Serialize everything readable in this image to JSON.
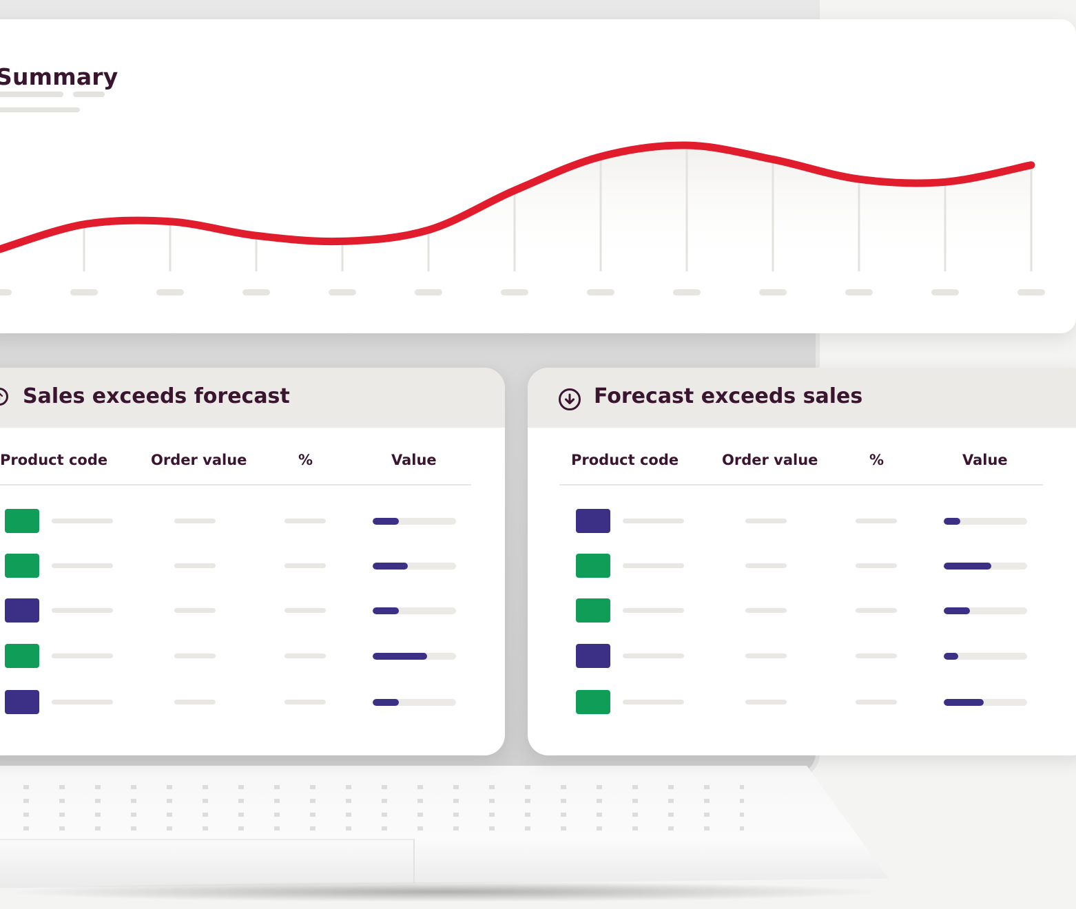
{
  "colors": {
    "accent_red": "#e11d2d",
    "title_text": "#3a1530",
    "swatch_green": "#0f9d58",
    "swatch_purple": "#3b2f86",
    "bar_fill": "#3b2f86",
    "placeholder": "#e8e7e3"
  },
  "summary": {
    "title": "Summary"
  },
  "chart_data": {
    "type": "line",
    "title": "Summary",
    "xlabel": "",
    "ylabel": "",
    "x": [
      1,
      2,
      3,
      4,
      5,
      6,
      7,
      8,
      9,
      10,
      11,
      12,
      13
    ],
    "series": [
      {
        "values": [
          33,
          42,
          43,
          38,
          36,
          40,
          54,
          66,
          70,
          65,
          58,
          57,
          63
        ]
      }
    ],
    "ylim": [
      0,
      100
    ],
    "grid": true,
    "tick_labels_visible": false
  },
  "tables": [
    {
      "title": "Sales exceeds forecast",
      "icon": "circle-arrow-up-icon",
      "columns": [
        "Product code",
        "Order value",
        "%",
        "Value"
      ],
      "rows": [
        {
          "swatch": "green",
          "value_fraction": 0.31
        },
        {
          "swatch": "green",
          "value_fraction": 0.42
        },
        {
          "swatch": "purple",
          "value_fraction": 0.31
        },
        {
          "swatch": "green",
          "value_fraction": 0.65
        },
        {
          "swatch": "purple",
          "value_fraction": 0.31
        }
      ]
    },
    {
      "title": "Forecast exceeds sales",
      "icon": "circle-arrow-down-icon",
      "columns": [
        "Product code",
        "Order value",
        "%",
        "Value"
      ],
      "rows": [
        {
          "swatch": "purple",
          "value_fraction": 0.2
        },
        {
          "swatch": "green",
          "value_fraction": 0.57
        },
        {
          "swatch": "green",
          "value_fraction": 0.31
        },
        {
          "swatch": "purple",
          "value_fraction": 0.17
        },
        {
          "swatch": "green",
          "value_fraction": 0.48
        }
      ]
    }
  ]
}
